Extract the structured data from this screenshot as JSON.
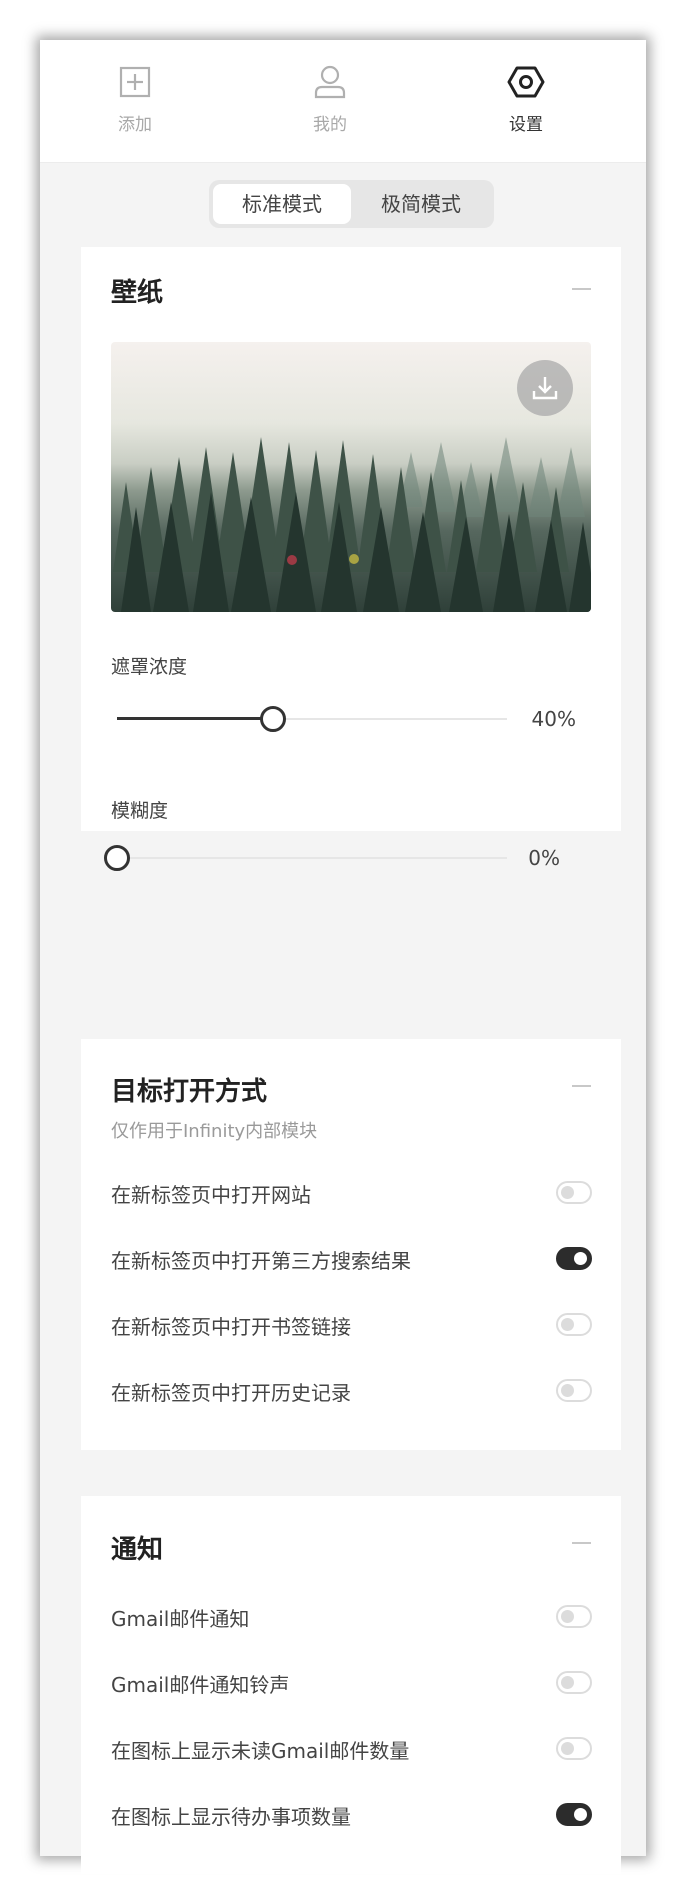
{
  "nav": {
    "items": [
      {
        "label": "添加",
        "icon": "plus-square-icon"
      },
      {
        "label": "我的",
        "icon": "user-icon"
      },
      {
        "label": "设置",
        "icon": "hexagon-settings-icon"
      }
    ],
    "active": "设置"
  },
  "mode": {
    "standard_label": "标准模式",
    "minimal_label": "极简模式",
    "selected": "标准模式"
  },
  "wallpaper": {
    "title": "壁纸",
    "download_icon": "download-icon",
    "mask_label": "遮罩浓度",
    "mask_value": 40,
    "mask_value_text": "40%",
    "blur_label": "模糊度",
    "blur_value": 0,
    "blur_value_text": "0%"
  },
  "open_mode": {
    "title": "目标打开方式",
    "subtitle": "仅作用于Infinity内部模块",
    "rows": [
      {
        "label": "在新标签页中打开网站",
        "enabled": false
      },
      {
        "label": "在新标签页中打开第三方搜索结果",
        "enabled": true
      },
      {
        "label": "在新标签页中打开书签链接",
        "enabled": false
      },
      {
        "label": "在新标签页中打开历史记录",
        "enabled": false
      }
    ]
  },
  "notify": {
    "title": "通知",
    "rows": [
      {
        "label": "Gmail邮件通知",
        "enabled": false
      },
      {
        "label": "Gmail邮件通知铃声",
        "enabled": false
      },
      {
        "label": "在图标上显示未读Gmail邮件数量",
        "enabled": false
      },
      {
        "label": "在图标上显示待办事项数量",
        "enabled": true
      }
    ]
  },
  "colors": {
    "accent": "#2c2c2c",
    "panel_bg": "#f4f4f4",
    "switch_off": "#dcdcdc"
  }
}
